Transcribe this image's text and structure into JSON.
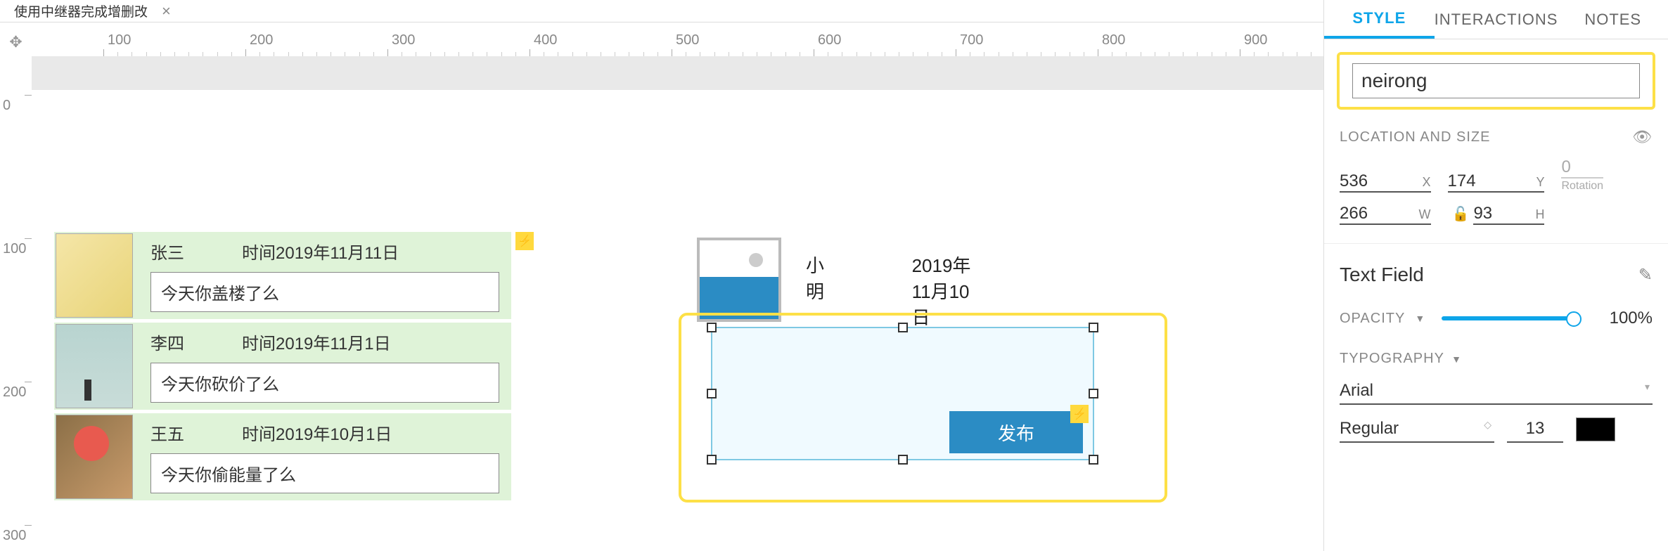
{
  "tab": {
    "title": "使用中继器完成增删改"
  },
  "ruler": {
    "h_ticks": [
      100,
      200,
      300,
      400,
      500,
      600,
      700,
      800,
      900
    ],
    "v_ticks": [
      100,
      200,
      300
    ]
  },
  "repeater": {
    "items": [
      {
        "name": "张三",
        "time": "时间2019年11月11日",
        "msg": "今天你盖楼了么"
      },
      {
        "name": "李四",
        "time": "时间2019年11月1日",
        "msg": "今天你砍价了么"
      },
      {
        "name": "王五",
        "time": "时间2019年10月1日",
        "msg": "今天你偷能量了么"
      }
    ]
  },
  "preview": {
    "name": "小明",
    "date": "2019年11月10日",
    "publish_btn": "发布"
  },
  "inspector": {
    "tabs": {
      "style": "STYLE",
      "interactions": "INTERACTIONS",
      "notes": "NOTES"
    },
    "widget_name": "neirong",
    "location_label": "LOCATION AND SIZE",
    "x": "536",
    "y": "174",
    "w": "266",
    "h": "93",
    "rotation": "0",
    "rotation_label": "Rotation",
    "x_label": "X",
    "y_label": "Y",
    "w_label": "W",
    "h_label": "H",
    "widget_type": "Text Field",
    "opacity_label": "OPACITY",
    "opacity_value": "100%",
    "typography_label": "TYPOGRAPHY",
    "font_family": "Arial",
    "font_weight": "Regular",
    "font_size": "13",
    "font_color": "#000000"
  }
}
